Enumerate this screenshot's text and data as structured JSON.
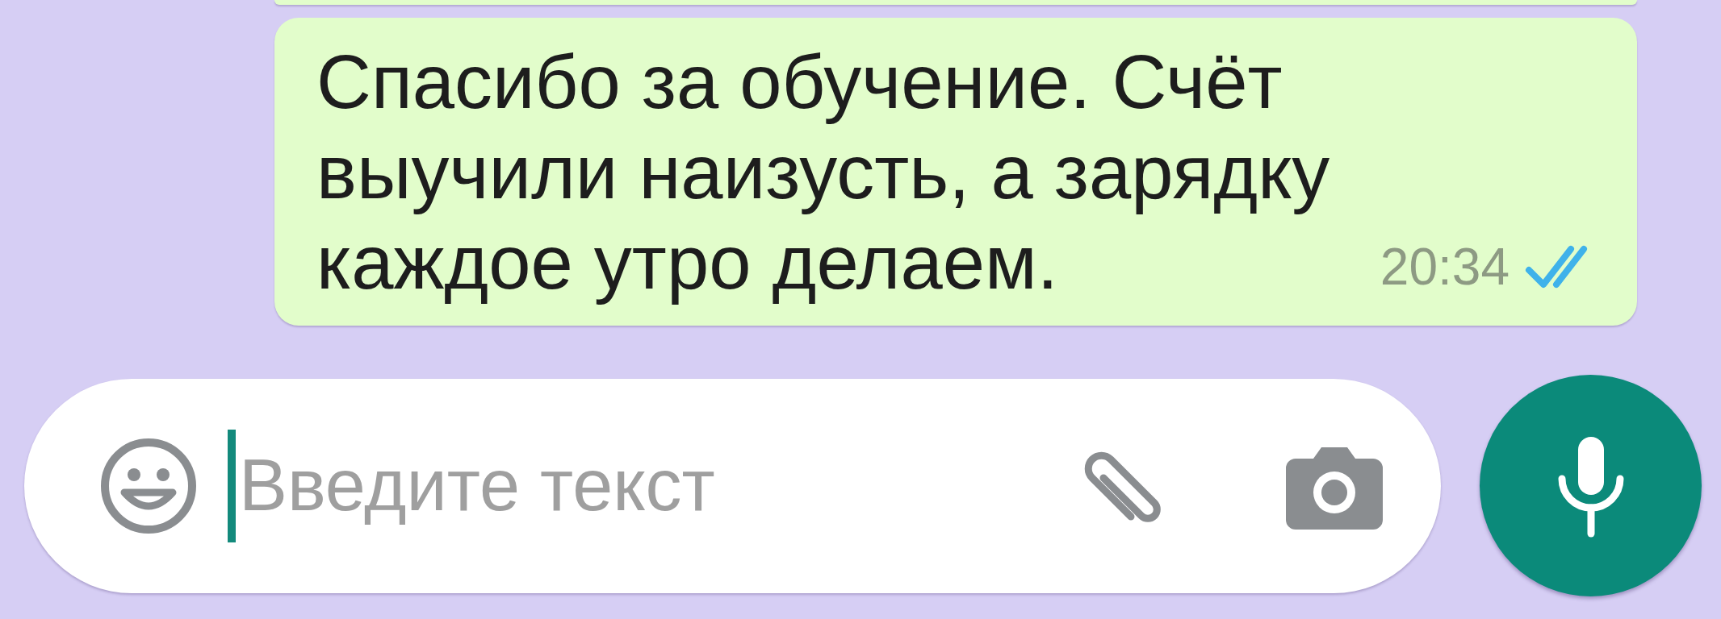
{
  "messages": [
    {
      "kind": "partial"
    },
    {
      "kind": "outgoing",
      "text": "Спасибо за обучение. Счёт выучили наизусть, а зарядку каждое утро делаем.",
      "time": "20:34",
      "read": true
    }
  ],
  "composer": {
    "placeholder": "Введите текст"
  }
}
